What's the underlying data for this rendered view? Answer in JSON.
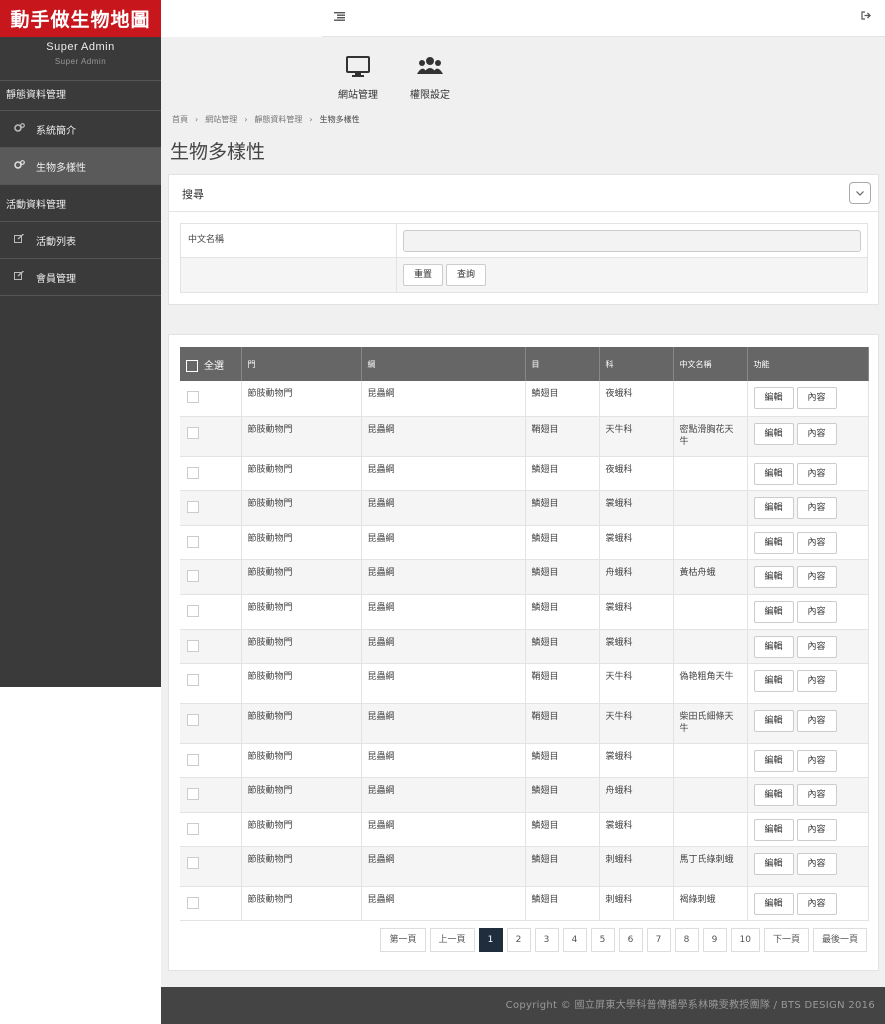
{
  "sidebar": {
    "logo_text": "動手做生物地圖",
    "user_name": "Super Admin",
    "user_role": "Super Admin",
    "section_static": "靜態資料管理",
    "item_system": "系統簡介",
    "item_bio": "生物多樣性",
    "section_activity": "活動資料管理",
    "item_activity_list": "活動列表",
    "item_member": "會員管理"
  },
  "modules": {
    "site": "網站管理",
    "perm": "權限設定"
  },
  "breadcrumb": [
    "首頁",
    "網站管理",
    "靜態資料管理",
    "生物多樣性"
  ],
  "page_title": "生物多樣性",
  "search": {
    "title": "搜尋",
    "field_label": "中文名稱",
    "value": "",
    "reset_label": "重置",
    "query_label": "查詢"
  },
  "table": {
    "headers": {
      "select_all": "全選",
      "phylum": "門",
      "class": "綱",
      "order": "目",
      "family": "科",
      "chinese_name": "中文名稱",
      "actions": "功能"
    },
    "edit_label": "編輯",
    "content_label": "內容",
    "rows": [
      {
        "phylum": "節肢動物門",
        "class": "昆蟲綱",
        "order": "鱗翅目",
        "family": "夜蛾科",
        "name": ""
      },
      {
        "phylum": "節肢動物門",
        "class": "昆蟲綱",
        "order": "鞘翅目",
        "family": "天牛科",
        "name": "密點滑胸花天牛"
      },
      {
        "phylum": "節肢動物門",
        "class": "昆蟲綱",
        "order": "鱗翅目",
        "family": "夜蛾科",
        "name": ""
      },
      {
        "phylum": "節肢動物門",
        "class": "昆蟲綱",
        "order": "鱗翅目",
        "family": "裳蛾科",
        "name": ""
      },
      {
        "phylum": "節肢動物門",
        "class": "昆蟲綱",
        "order": "鱗翅目",
        "family": "裳蛾科",
        "name": ""
      },
      {
        "phylum": "節肢動物門",
        "class": "昆蟲綱",
        "order": "鱗翅目",
        "family": "舟蛾科",
        "name": "黃枯舟蛾"
      },
      {
        "phylum": "節肢動物門",
        "class": "昆蟲綱",
        "order": "鱗翅目",
        "family": "裳蛾科",
        "name": ""
      },
      {
        "phylum": "節肢動物門",
        "class": "昆蟲綱",
        "order": "鱗翅目",
        "family": "裳蛾科",
        "name": ""
      },
      {
        "phylum": "節肢動物門",
        "class": "昆蟲綱",
        "order": "鞘翅目",
        "family": "天牛科",
        "name": "偽艳粗角天牛"
      },
      {
        "phylum": "節肢動物門",
        "class": "昆蟲綱",
        "order": "鞘翅目",
        "family": "天牛科",
        "name": "柴田氏細條天牛"
      },
      {
        "phylum": "節肢動物門",
        "class": "昆蟲綱",
        "order": "鱗翅目",
        "family": "裳蛾科",
        "name": ""
      },
      {
        "phylum": "節肢動物門",
        "class": "昆蟲綱",
        "order": "鱗翅目",
        "family": "舟蛾科",
        "name": ""
      },
      {
        "phylum": "節肢動物門",
        "class": "昆蟲綱",
        "order": "鱗翅目",
        "family": "裳蛾科",
        "name": ""
      },
      {
        "phylum": "節肢動物門",
        "class": "昆蟲綱",
        "order": "鱗翅目",
        "family": "刺蛾科",
        "name": "馬丁氏綠刺蛾"
      },
      {
        "phylum": "節肢動物門",
        "class": "昆蟲綱",
        "order": "鱗翅目",
        "family": "刺蛾科",
        "name": "褐綠刺蛾"
      }
    ]
  },
  "pagination": {
    "first": "第一頁",
    "prev": "上一頁",
    "pages": [
      "1",
      "2",
      "3",
      "4",
      "5",
      "6",
      "7",
      "8",
      "9",
      "10"
    ],
    "active_page": "1",
    "next": "下一頁",
    "last": "最後一頁"
  },
  "footer": "Copyright © 國立屏東大學科普傳播學系林曉雯教授團隊 / BTS DESIGN 2016",
  "icons": {
    "menu": "list-icon",
    "logout": "sign-out-icon",
    "site": "monitor-icon",
    "perm": "users-icon",
    "sidebar_gear": "gears-icon",
    "sidebar_edit": "edit-icon",
    "collapse": "chevron-down-icon"
  },
  "colors": {
    "logo_bg": "#c8161d",
    "sidebar_bg": "#3a3a3a",
    "table_header_bg": "#666666",
    "active_page_bg": "#1f2d3d"
  }
}
